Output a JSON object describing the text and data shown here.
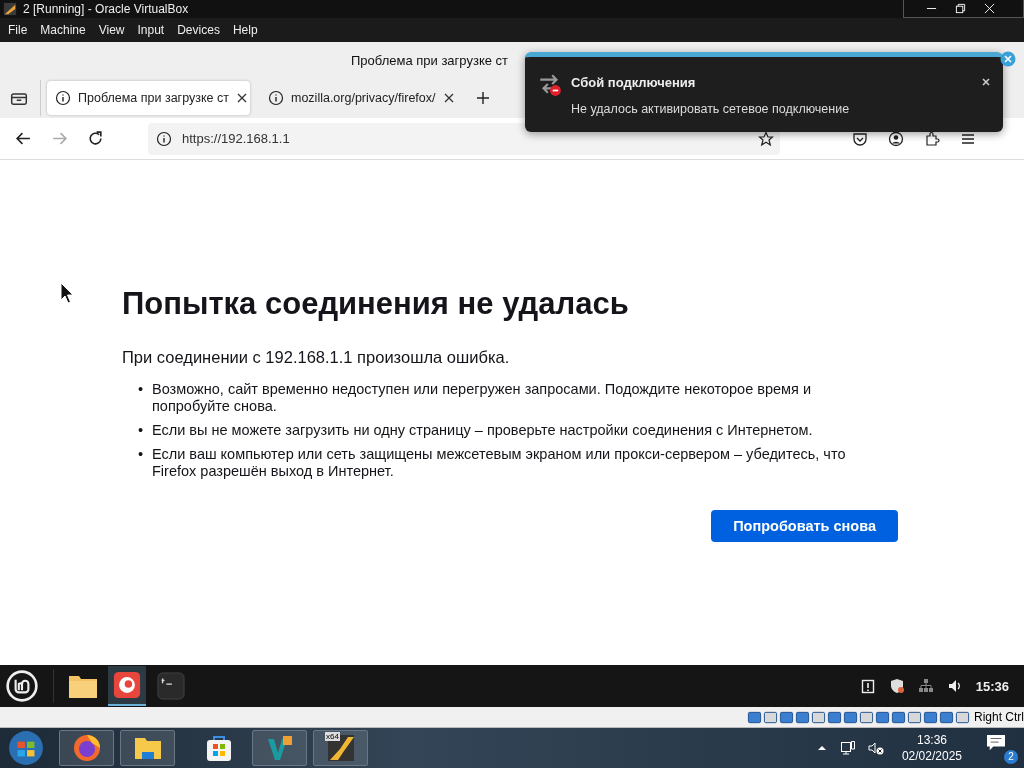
{
  "vm_window": {
    "title": "2 [Running] - Oracle VirtualBox",
    "menu": [
      "File",
      "Machine",
      "View",
      "Input",
      "Devices",
      "Help"
    ]
  },
  "browser": {
    "title": "Проблема при загрузке ст",
    "tabs": [
      {
        "label": "Проблема при загрузке ст",
        "selected": true
      },
      {
        "label": "mozilla.org/privacy/firefox/",
        "selected": false
      }
    ],
    "url": "https://192.168.1.1"
  },
  "page": {
    "heading": "Попытка соединения не удалась",
    "intro": "При соединении с 192.168.1.1 произошла ошибка.",
    "bullets": [
      {
        "marker": "•",
        "text": "Возможно, сайт временно недоступен или перегружен запросами. Подождите некоторое время и попробуйте снова."
      },
      {
        "marker": "•",
        "text": "Если вы не можете загрузить ни одну страницу – проверьте настройки соединения с Интернетом."
      },
      {
        "marker": "•",
        "text": "Если ваш компьютер или сеть защищены межсетевым экраном или прокси-сервером – убедитесь, что Firefox разрешён выход в Интернет."
      }
    ],
    "retry_button": "Попробовать снова"
  },
  "notification": {
    "title": "Сбой подключения",
    "message": "Не удалось активировать сетевое подключение"
  },
  "guest_panel": {
    "apps": [
      {
        "kind": "folder",
        "selected": false
      },
      {
        "kind": "firefox",
        "selected": true
      },
      {
        "kind": "terminal",
        "selected": false
      }
    ],
    "clock": "15:36"
  },
  "vm_status": {
    "host_key": "Right Ctrl"
  },
  "host_taskbar": {
    "apps": [
      {
        "kind": "firefox"
      },
      {
        "kind": "explorer"
      },
      {
        "kind": "store"
      },
      {
        "kind": "vscode"
      },
      {
        "kind": "debugger",
        "badge": "x64"
      }
    ],
    "time": "13:36",
    "date": "02/02/2025",
    "notifications": "2"
  }
}
